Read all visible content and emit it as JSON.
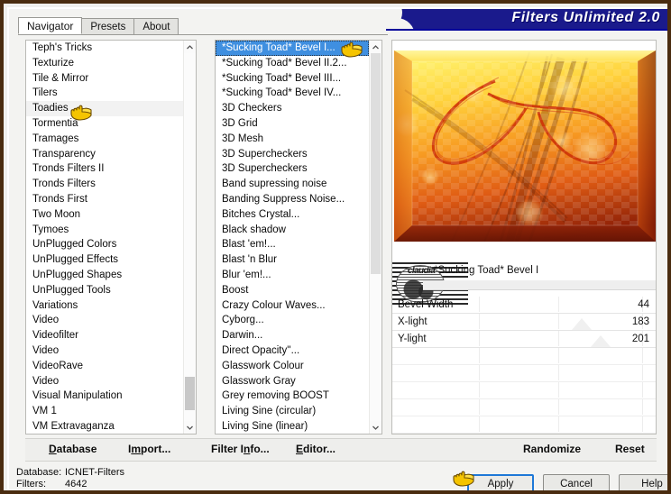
{
  "window": {
    "title": "Filters Unlimited 2.0",
    "border_color": "#4a2c10",
    "title_bg": "#1a1a8c"
  },
  "tabs": [
    {
      "label": "Navigator",
      "active": true
    },
    {
      "label": "Presets",
      "active": false
    },
    {
      "label": "About",
      "active": false
    }
  ],
  "navigator_list": {
    "items": [
      "Teph's Tricks",
      "Texturize",
      "Tile & Mirror",
      "Tilers",
      "Toadies",
      "Tormentia",
      "Tramages",
      "Transparency",
      "Tronds Filters II",
      "Tronds Filters",
      "Tronds First",
      "Two Moon",
      "Tymoes",
      "UnPlugged Colors",
      "UnPlugged Effects",
      "UnPlugged Shapes",
      "UnPlugged Tools",
      "Variations",
      "Video",
      "Videofilter",
      "Video",
      "VideoRave",
      "Video",
      "Visual Manipulation",
      "VM 1",
      "VM Extravaganza"
    ],
    "hovered_index": 4,
    "scroll_thumb_top_pct": 88,
    "scroll_thumb_height_pct": 9
  },
  "filter_list": {
    "items": [
      "*Sucking Toad*  Bevel I...",
      "*Sucking Toad*  Bevel II.2...",
      "*Sucking Toad*  Bevel III...",
      "*Sucking Toad*  Bevel IV...",
      "3D Checkers",
      "3D Grid",
      "3D Mesh",
      "3D Supercheckers",
      "3D Supercheckers",
      "Band supressing noise",
      "Banding Suppress Noise...",
      "Bitches Crystal...",
      "Black shadow",
      "Blast 'em!...",
      "Blast 'n Blur",
      "Blur 'em!...",
      "Boost",
      "Crazy Colour Waves...",
      "Cyborg...",
      "Darwin...",
      "Direct Opacity''...",
      "Glasswork Colour",
      "Glasswork Gray",
      "Grey removing BOOST",
      "Living Sine (circular)",
      "Living Sine (linear)"
    ],
    "selected_index": 0,
    "scroll_thumb_top_pct": 0,
    "scroll_thumb_height_pct": 60
  },
  "preview": {
    "filter_name": "*Sucking Toad*  Bevel I",
    "logo_text": "claudia"
  },
  "parameters": {
    "rows": [
      {
        "label": "Bevel Width",
        "value": "44",
        "marker_pct": null
      },
      {
        "label": "X-light",
        "value": "183",
        "marker_pct": 72
      },
      {
        "label": "Y-light",
        "value": "201",
        "marker_pct": 79
      }
    ],
    "empty_rows": 8
  },
  "action_row": {
    "database": {
      "label": "Database",
      "accel": "D"
    },
    "import": {
      "label": "Import...",
      "accel": "m"
    },
    "filter_info": {
      "label": "Filter Info...",
      "accel": "n"
    },
    "editor": {
      "label": "Editor...",
      "accel": "E"
    },
    "randomize": {
      "label": "Randomize"
    },
    "reset": {
      "label": "Reset"
    }
  },
  "status": {
    "database_key": "Database:",
    "database_value": "ICNET-Filters",
    "filters_key": "Filters:",
    "filters_value": "4642"
  },
  "dialog_buttons": {
    "apply": "Apply",
    "cancel": "Cancel",
    "help": "Help",
    "focus_color": "#1e78d7"
  },
  "annotations": {
    "hand_cursor_icon": "pointing-hand-icon",
    "hand_color": "#f2c200",
    "count": 3
  }
}
